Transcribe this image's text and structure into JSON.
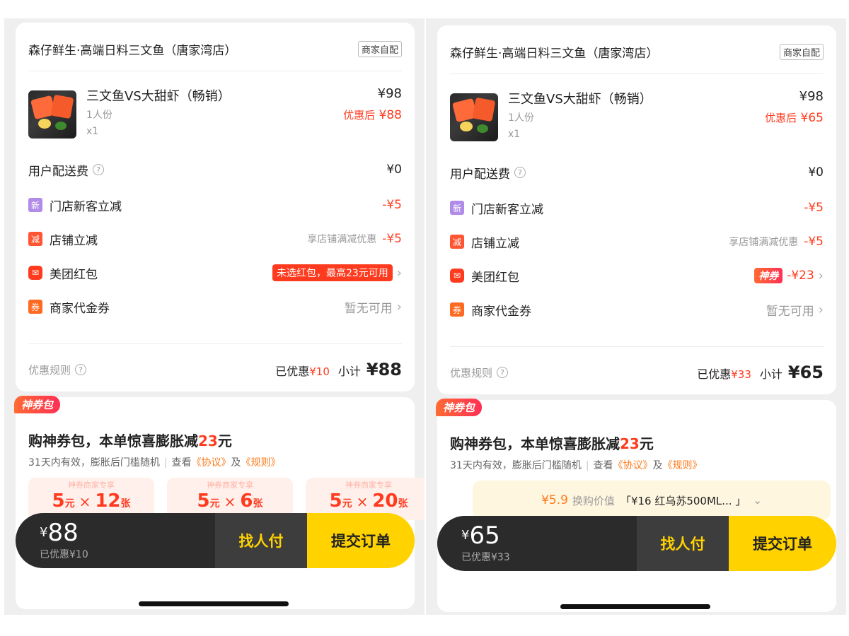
{
  "panels": [
    {
      "store": {
        "name": "森仔鲜生·高端日料三文鱼（唐家湾店）",
        "delivery_badge": "商家自配"
      },
      "product": {
        "name": "三文鱼VS大甜虾（畅销）",
        "spec": "1人份",
        "qty": "x1",
        "price": "¥98",
        "discount_label": "优惠后",
        "discount_price": "¥88"
      },
      "delivery_fee": {
        "label": "用户配送费",
        "info_icon": "?",
        "value": "¥0"
      },
      "new_customer": {
        "tag": "新",
        "label": "门店新客立减",
        "value": "-¥5"
      },
      "store_discount": {
        "tag": "减",
        "label": "店铺立减",
        "note": "享店铺满减优惠",
        "value": "-¥5"
      },
      "red_packet": {
        "icon": "red-envelope-icon",
        "label": "美团红包",
        "pill": "未选红包，最高23元可用",
        "chevron": "›"
      },
      "voucher": {
        "tag": "券",
        "label": "商家代金券",
        "value": "暂无可用",
        "chevron": "›"
      },
      "summary": {
        "rules_label": "优惠规则",
        "info_icon": "?",
        "saved_label": "已优惠",
        "saved_value": "¥10",
        "subtotal_label": "小计",
        "subtotal_value": "¥88"
      },
      "coupon_pack": {
        "badge": "神券包",
        "title_prefix": "购神券包，本单惊喜膨胀减",
        "title_amount": "23",
        "title_suffix": "元",
        "sub_text": "31天内有效，膨胀后门槛随机",
        "bar": "|",
        "view": "查看",
        "link1": "《协议》",
        "and": "及",
        "link2": "《规则》",
        "vouchers": [
          {
            "head": "神券商家专享",
            "amount": "5",
            "unit": "元",
            "times": "×",
            "count": "12",
            "count_unit": "张"
          },
          {
            "head": "神券商家专享",
            "amount": "5",
            "unit": "元",
            "times": "×",
            "count": "6",
            "count_unit": "张"
          },
          {
            "head": "神券商家专享",
            "amount": "5",
            "unit": "元",
            "times": "×",
            "count": "20",
            "count_unit": "张"
          }
        ]
      },
      "paybar": {
        "currency": "¥",
        "total": "88",
        "saved": "已优惠¥10",
        "friend": "找人付",
        "submit": "提交订单"
      }
    },
    {
      "store": {
        "name": "森仔鲜生·高端日料三文鱼（唐家湾店）",
        "delivery_badge": "商家自配"
      },
      "product": {
        "name": "三文鱼VS大甜虾（畅销）",
        "spec": "1人份",
        "qty": "x1",
        "price": "¥98",
        "discount_label": "优惠后",
        "discount_price": "¥65"
      },
      "delivery_fee": {
        "label": "用户配送费",
        "info_icon": "?",
        "value": "¥0"
      },
      "new_customer": {
        "tag": "新",
        "label": "门店新客立减",
        "value": "-¥5"
      },
      "store_discount": {
        "tag": "减",
        "label": "店铺立减",
        "note": "享店铺满减优惠",
        "value": "-¥5"
      },
      "red_packet": {
        "icon": "red-envelope-icon",
        "label": "美团红包",
        "badge": "神券",
        "value": "-¥23",
        "chevron": "›"
      },
      "voucher": {
        "tag": "券",
        "label": "商家代金券",
        "value": "暂无可用",
        "chevron": "›"
      },
      "summary": {
        "rules_label": "优惠规则",
        "info_icon": "?",
        "saved_label": "已优惠",
        "saved_value": "¥33",
        "subtotal_label": "小计",
        "subtotal_value": "¥65"
      },
      "coupon_pack": {
        "badge": "神券包",
        "title_prefix": "购神券包，本单惊喜膨胀减",
        "title_amount": "23",
        "title_suffix": "元",
        "sub_text": "31天内有效，膨胀后门槛随机",
        "bar": "|",
        "view": "查看",
        "link1": "《协议》",
        "and": "及",
        "link2": "《规则》",
        "exchange": {
          "price": "¥5.9",
          "label": "换购价值",
          "item": "「¥16 红乌苏500ML... 」",
          "chevron": "⌄"
        }
      },
      "paybar": {
        "currency": "¥",
        "total": "65",
        "saved": "已优惠¥33",
        "friend": "找人付",
        "submit": "提交订单"
      }
    }
  ],
  "colors": {
    "accent_red": "#ff3b1f",
    "pay_yellow": "#ffd200",
    "pay_dark": "#2b2b2b",
    "link_orange": "#ff7a1a"
  }
}
